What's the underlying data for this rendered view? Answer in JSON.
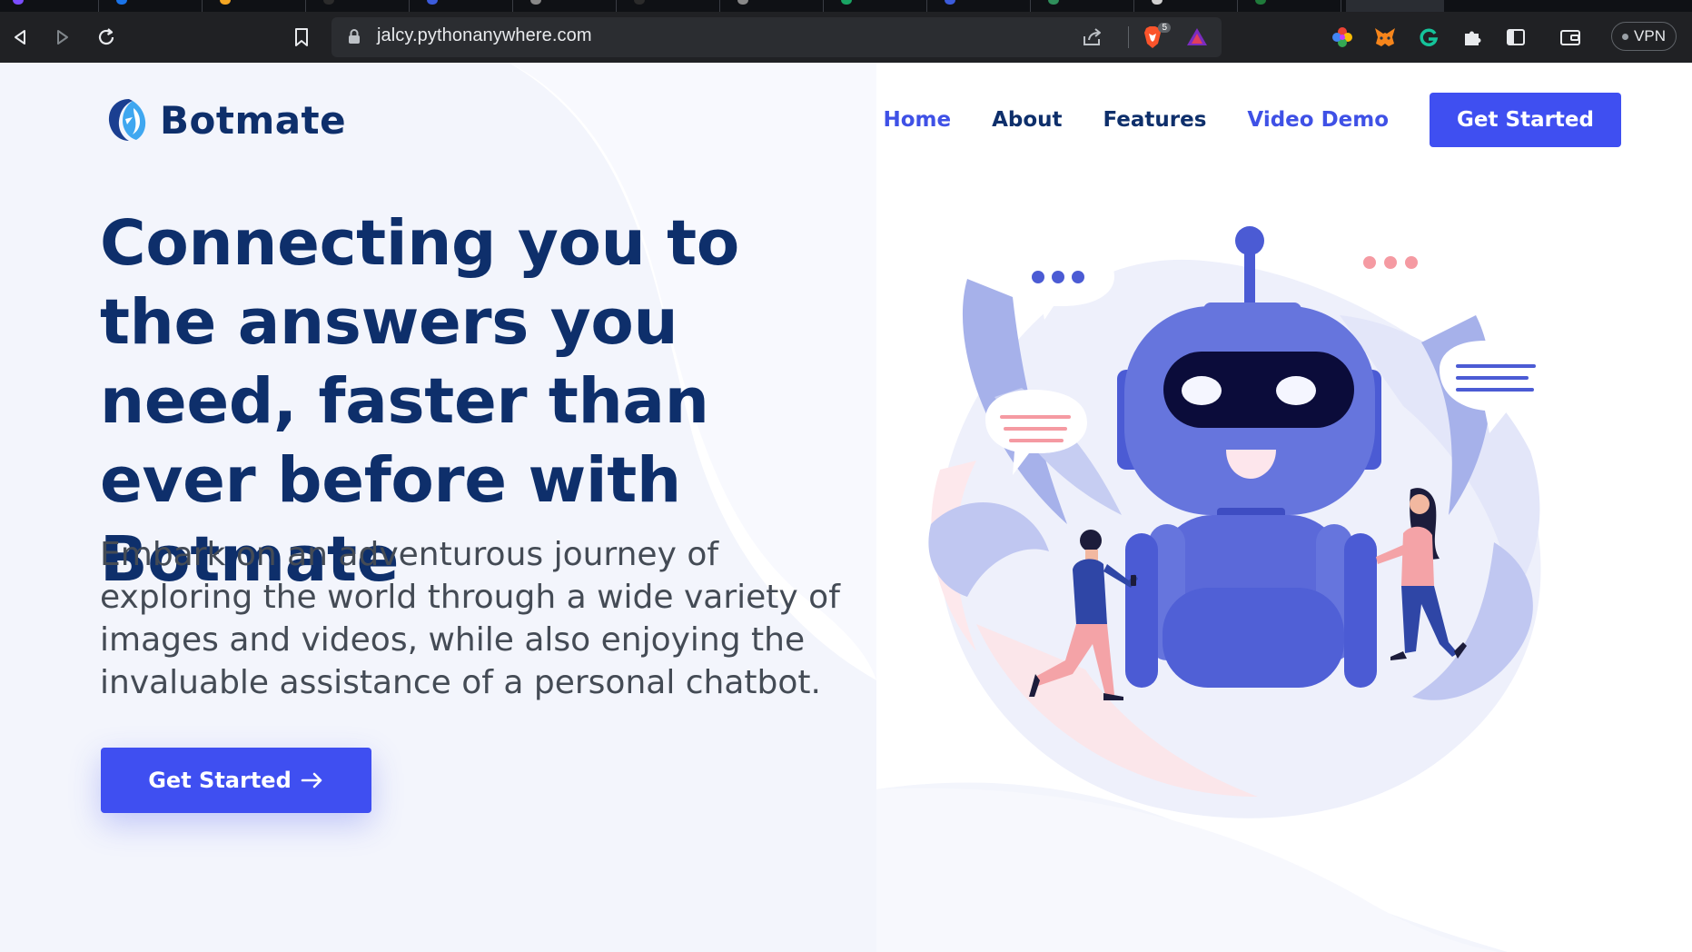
{
  "browser": {
    "url": "jalcy.pythonanywhere.com",
    "shields_count": "5",
    "vpn_label": "VPN",
    "tab_favicon_colors": [
      "#7b4dff",
      "#1a73e8",
      "#f5a623",
      "#2b2b2b",
      "#3b5bdb",
      "#888888",
      "#2b2b2b",
      "#888888",
      "#19a463",
      "#3b5bdb",
      "#2f8f5b",
      "#d0d0d0",
      "#1f7a3a"
    ]
  },
  "site": {
    "brand": "Botmate",
    "nav": {
      "home": "Home",
      "about": "About",
      "features": "Features",
      "video_demo": "Video Demo",
      "get_started": "Get Started"
    },
    "hero": {
      "title": "Connecting you to the answers you need, faster than ever before with Botmate",
      "subtitle": "Embark on an adventurous journey of exploring the world through a wide variety of images and videos, while also enjoying the invaluable assistance of a personal chatbot.",
      "button": "Get Started",
      "button_icon": "arrow-right-icon"
    }
  },
  "colors": {
    "brand_dark": "#0e2f6b",
    "accent": "#3f4ff1",
    "robot": "#5a68d8"
  }
}
